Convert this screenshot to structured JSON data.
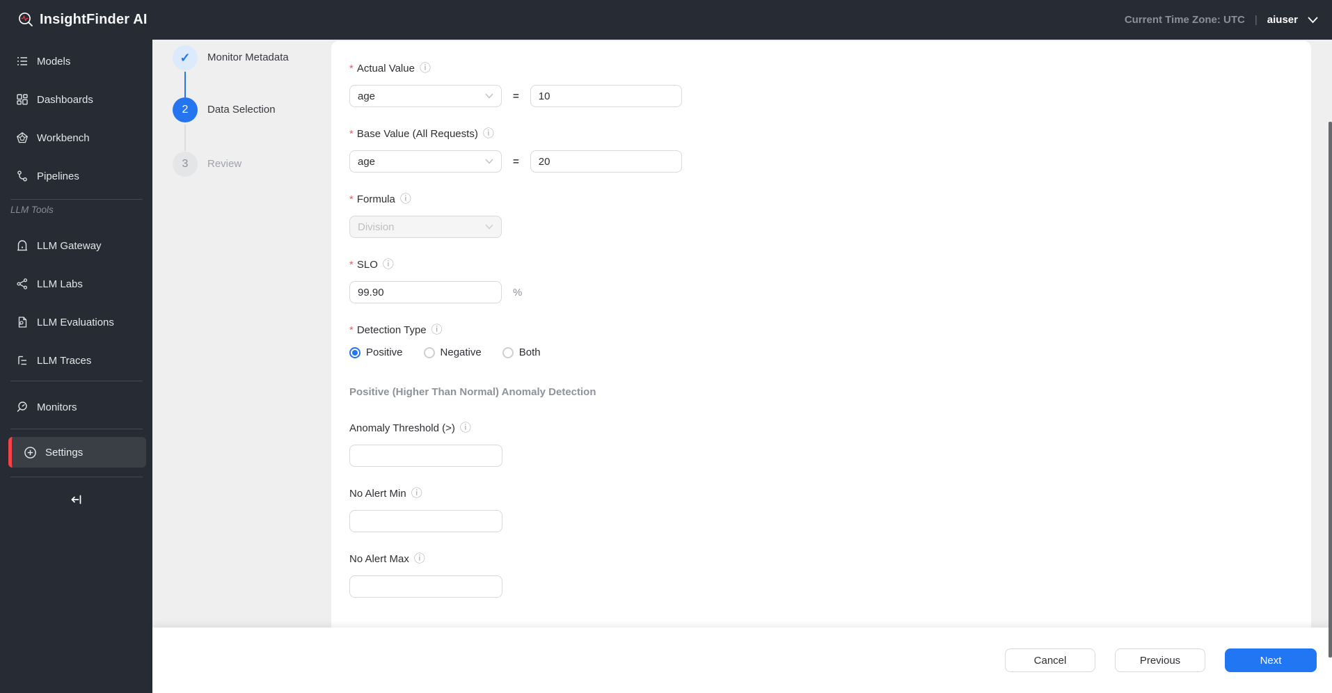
{
  "header": {
    "logo_text": "InsightFinder AI",
    "timezone_label": "Current Time Zone: UTC",
    "separator": "|",
    "username": "aiuser"
  },
  "sidebar": {
    "items": [
      {
        "label": "Models",
        "icon": "list-icon"
      },
      {
        "label": "Dashboards",
        "icon": "grid-icon"
      },
      {
        "label": "Workbench",
        "icon": "pentagon-icon"
      },
      {
        "label": "Pipelines",
        "icon": "branch-icon"
      }
    ],
    "section_label": "LLM Tools",
    "llm_items": [
      {
        "label": "LLM Gateway",
        "icon": "gateway-icon"
      },
      {
        "label": "LLM Labs",
        "icon": "share-icon"
      },
      {
        "label": "LLM Evaluations",
        "icon": "doc-search-icon"
      },
      {
        "label": "LLM Traces",
        "icon": "trace-list-icon"
      }
    ],
    "monitors": {
      "label": "Monitors",
      "icon": "monitor-search-icon"
    },
    "settings": {
      "label": "Settings",
      "icon": "plus-circle-icon",
      "active": true
    }
  },
  "steps": [
    {
      "label": "Monitor Metadata",
      "state": "done"
    },
    {
      "label": "Data Selection",
      "number": "2",
      "state": "active"
    },
    {
      "label": "Review",
      "number": "3",
      "state": "pending"
    }
  ],
  "form": {
    "required_mark": "*",
    "actual_value": {
      "label": "Actual Value",
      "select_value": "age",
      "equals": "=",
      "input_value": "10"
    },
    "base_value": {
      "label": "Base Value (All Requests)",
      "select_value": "age",
      "equals": "=",
      "input_value": "20"
    },
    "formula": {
      "label": "Formula",
      "select_value": "Division",
      "disabled": true
    },
    "slo": {
      "label": "SLO",
      "input_value": "99.90",
      "suffix": "%"
    },
    "detection_type": {
      "label": "Detection Type",
      "options": [
        {
          "label": "Positive",
          "selected": true
        },
        {
          "label": "Negative",
          "selected": false
        },
        {
          "label": "Both",
          "selected": false
        }
      ]
    },
    "section_heading": "Positive (Higher Than Normal) Anomaly Detection",
    "anomaly_threshold": {
      "label": "Anomaly Threshold (>)",
      "input_value": ""
    },
    "no_alert_min": {
      "label": "No Alert Min",
      "input_value": ""
    },
    "no_alert_max": {
      "label": "No Alert Max",
      "input_value": ""
    }
  },
  "footer": {
    "cancel_label": "Cancel",
    "previous_label": "Previous",
    "next_label": "Next"
  },
  "icons": {
    "check": "✓",
    "info": "ⓘ"
  },
  "colors": {
    "accent_blue": "#2176f3",
    "danger_red": "#f5222d",
    "logo_red": "#e8353c",
    "sidebar_bg": "#272b33",
    "page_bg": "#efefef",
    "step_done_bg": "#dceafd",
    "disabled_bg": "#f5f5f5",
    "border": "#d9d9d9"
  }
}
